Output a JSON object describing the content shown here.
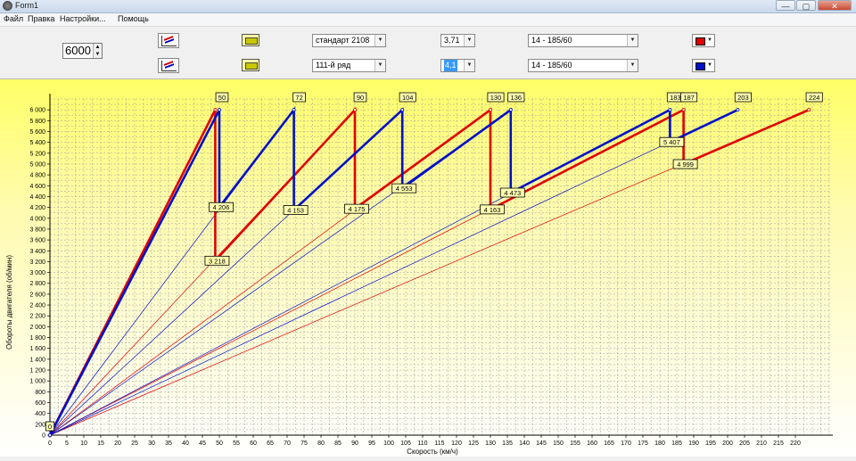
{
  "window": {
    "title": "Form1",
    "minimize": "—",
    "maximize": "▢",
    "close": "✕"
  },
  "menu": [
    "Файл",
    "Правка",
    "Настройки...",
    "Помощь"
  ],
  "rpm_input": "6000",
  "rows": [
    {
      "gearbox": "стандарт 2108",
      "final_drive": "3,71",
      "final_selected": false,
      "tire": "14 - 185/60",
      "color": "#e00000"
    },
    {
      "gearbox": "111-й ряд",
      "final_drive": "4,1",
      "final_selected": true,
      "tire": "14 - 185/60",
      "color": "#0010c8"
    }
  ],
  "chart_data": {
    "type": "line",
    "xlabel": "Скорость (км/ч)",
    "ylabel": "Обороты двигателя (об/мин)",
    "xlim": [
      0,
      230
    ],
    "ylim": [
      0,
      6200
    ],
    "x_ticks": [
      0,
      5,
      10,
      15,
      20,
      25,
      30,
      35,
      40,
      45,
      50,
      55,
      60,
      65,
      70,
      75,
      80,
      85,
      90,
      95,
      100,
      105,
      110,
      115,
      120,
      125,
      130,
      135,
      140,
      145,
      150,
      155,
      160,
      165,
      170,
      175,
      180,
      185,
      190,
      195,
      200,
      205,
      210,
      215,
      220
    ],
    "y_ticks": [
      0,
      200,
      400,
      600,
      800,
      1000,
      1200,
      1400,
      1600,
      1800,
      2000,
      2200,
      2400,
      2600,
      2800,
      3000,
      3200,
      3400,
      3600,
      3800,
      4000,
      4200,
      4400,
      4600,
      4800,
      5000,
      5200,
      5400,
      5600,
      5800,
      6000
    ],
    "y_tick_labels": [
      "0",
      "200",
      "400",
      "600",
      "800",
      "1 000",
      "1 200",
      "1 400",
      "1 600",
      "1 800",
      "2 000",
      "2 200",
      "2 400",
      "2 600",
      "2 800",
      "3 000",
      "3 200",
      "3 400",
      "3 600",
      "3 800",
      "4 000",
      "4 200",
      "4 400",
      "4 600",
      "4 800",
      "5 000",
      "5 200",
      "5 400",
      "5 600",
      "5 800",
      "6 000"
    ],
    "grid": true,
    "series": [
      {
        "color": "#e00000",
        "shift_path": [
          [
            0,
            0
          ],
          [
            48.8,
            6000
          ],
          [
            48.8,
            3218
          ],
          [
            90,
            6000
          ],
          [
            90,
            4175
          ],
          [
            130,
            6000
          ],
          [
            130,
            4163
          ],
          [
            187,
            6000
          ],
          [
            187,
            4999
          ],
          [
            224,
            6000
          ]
        ],
        "ratio_lines": [
          48.8,
          90,
          130,
          187,
          224
        ]
      },
      {
        "color": "#0010c8",
        "shift_path": [
          [
            0,
            0
          ],
          [
            50,
            6000
          ],
          [
            50,
            4206
          ],
          [
            72,
            6000
          ],
          [
            72,
            4153
          ],
          [
            104,
            6000
          ],
          [
            104,
            4553
          ],
          [
            136,
            6000
          ],
          [
            136,
            4473
          ],
          [
            183,
            6000
          ],
          [
            183,
            5407
          ],
          [
            203,
            6000
          ]
        ],
        "ratio_lines": [
          50,
          72,
          104,
          136,
          183,
          203
        ]
      }
    ],
    "speed_labels": [
      {
        "x": 49.2,
        "text": "50"
      },
      {
        "x": 72,
        "text": "72"
      },
      {
        "x": 90,
        "text": "90"
      },
      {
        "x": 104,
        "text": "104"
      },
      {
        "x": 130,
        "text": "130"
      },
      {
        "x": 136,
        "text": "136"
      },
      {
        "x": 183,
        "text": "183"
      },
      {
        "x": 187,
        "text": "187"
      },
      {
        "x": 203,
        "text": "203"
      },
      {
        "x": 224,
        "text": "224"
      }
    ],
    "rpm_labels": [
      {
        "x": 50,
        "y": 4206,
        "text": "4 206"
      },
      {
        "x": 48.8,
        "y": 3218,
        "text": "3 218"
      },
      {
        "x": 72,
        "y": 4153,
        "text": "4 153"
      },
      {
        "x": 90,
        "y": 4175,
        "text": "4 175"
      },
      {
        "x": 104,
        "y": 4553,
        "text": "4 553"
      },
      {
        "x": 130,
        "y": 4163,
        "text": "4 163"
      },
      {
        "x": 136,
        "y": 4473,
        "text": "4 473"
      },
      {
        "x": 183,
        "y": 5407,
        "text": "5 407"
      },
      {
        "x": 187,
        "y": 4999,
        "text": "4 999"
      },
      {
        "x": 0,
        "y": 0,
        "text": "0"
      }
    ]
  }
}
